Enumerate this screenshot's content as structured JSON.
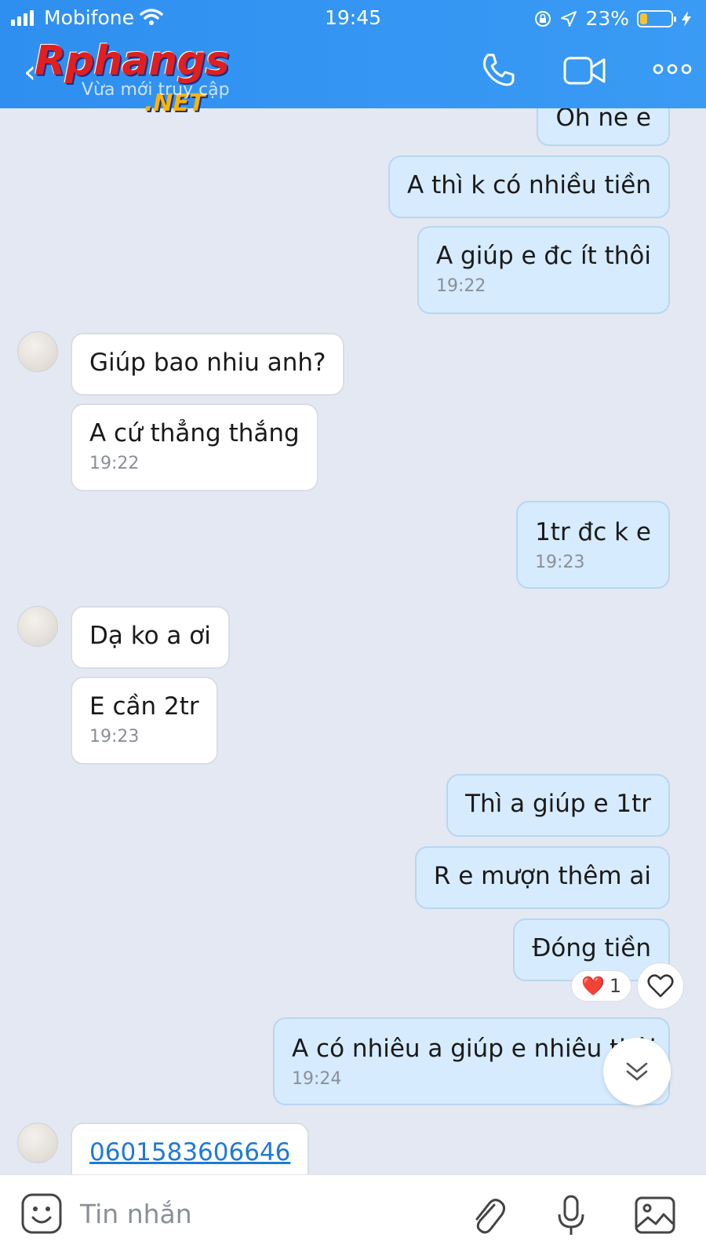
{
  "status_bar": {
    "carrier": "Mobifone",
    "time": "19:45",
    "battery_text": "23%",
    "battery_level": 0.23
  },
  "header": {
    "logo_main": "Rphangs",
    "logo_suffix": ".NET",
    "presence": "Vừa mới truy cập"
  },
  "messages": [
    {
      "dir": "out",
      "text": "Oh ne e",
      "time": ""
    },
    {
      "dir": "out",
      "text": "A thì k có nhiều tiền",
      "time": ""
    },
    {
      "dir": "out",
      "text": "A giúp e đc ít thôi",
      "time": "19:22"
    },
    {
      "dir": "in",
      "text": "Giúp bao nhiu anh?",
      "time": ""
    },
    {
      "dir": "in",
      "text": "A cứ thẳng thắng",
      "time": "19:22"
    },
    {
      "dir": "out",
      "text": "1tr đc k e",
      "time": "19:23"
    },
    {
      "dir": "in",
      "text": "Dạ ko a ơi",
      "time": ""
    },
    {
      "dir": "in",
      "text": "E cần 2tr",
      "time": "19:23"
    },
    {
      "dir": "out",
      "text": "Thì a giúp e 1tr",
      "time": ""
    },
    {
      "dir": "out",
      "text": "R e mượn thêm ai",
      "time": ""
    },
    {
      "dir": "out",
      "text": "Đóng tiền",
      "time": ""
    },
    {
      "dir": "out",
      "text": "A có nhiêu a giúp e nhiêu thôi",
      "time": "19:24"
    },
    {
      "dir": "in",
      "text": "0601583606646",
      "time": ""
    }
  ],
  "reaction": {
    "emoji": "❤️",
    "count": "1"
  },
  "input": {
    "placeholder": "Tin nhắn"
  },
  "colors": {
    "header": "#3a9bf5",
    "outgoing_bubble": "#d6ebfd",
    "incoming_bubble": "#ffffff",
    "background": "#e3e8f2"
  }
}
